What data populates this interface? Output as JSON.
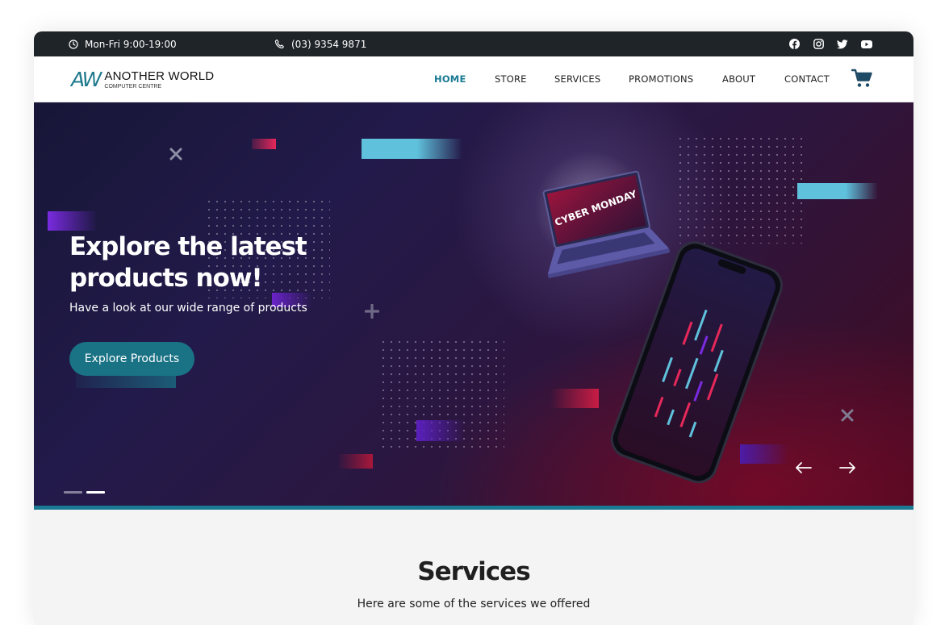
{
  "topbar": {
    "hours": "Mon-Fri 9:00-19:00",
    "phone": "(03) 9354 9871",
    "socials": [
      "facebook-icon",
      "instagram-icon",
      "twitter-icon",
      "youtube-icon"
    ]
  },
  "header": {
    "logo_mark": "AW",
    "brand": "ANOTHER WORLD",
    "brand_sub": "COMPUTER CENTRE",
    "nav": [
      "HOME",
      "STORE",
      "SERVICES",
      "PROMOTIONS",
      "ABOUT",
      "CONTACT"
    ],
    "active_nav": "HOME",
    "cart_icon": "cart-icon"
  },
  "hero": {
    "title": "Explore the latest products now!",
    "subtitle": "Have a look at our wide range of products",
    "cta": "Explore Products",
    "laptop_screen_text": "CYBER MONDAY",
    "slide_count": 2,
    "active_slide": 2,
    "prev_icon": "arrow-left-icon",
    "next_icon": "arrow-right-icon"
  },
  "services": {
    "title": "Services",
    "subtitle": "Here are some of the services we offered"
  },
  "colors": {
    "accent": "#1a7a93",
    "topbar_bg": "#1f2428",
    "button_bg": "#1a7285"
  }
}
